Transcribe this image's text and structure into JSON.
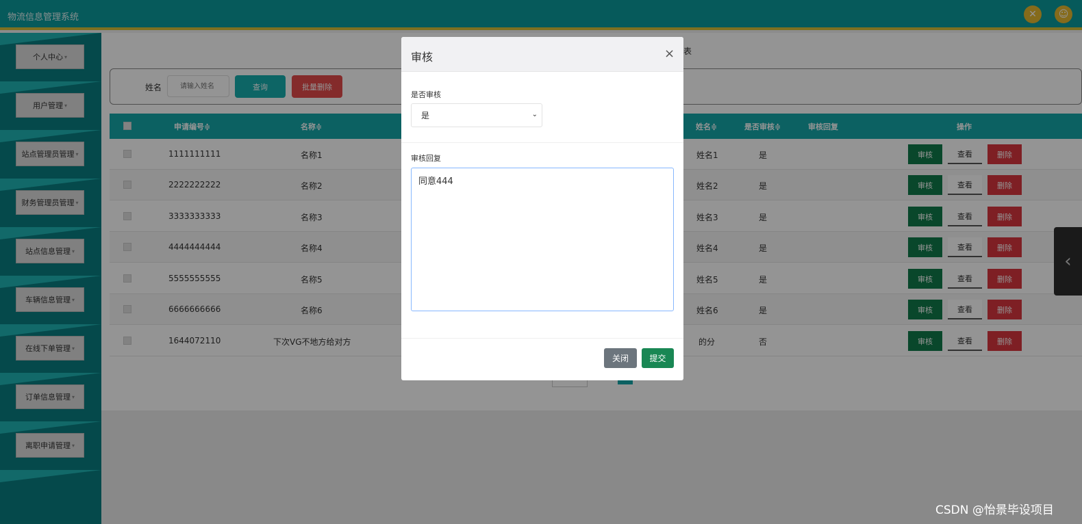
{
  "app": {
    "title": "物流信息管理系统"
  },
  "header": {
    "icon_fullscreen": "close-x-icon",
    "icon_user": "user-icon"
  },
  "sidebar": {
    "items": [
      {
        "label": "个人中心"
      },
      {
        "label": "用户管理"
      },
      {
        "label": "站点管理员管理"
      },
      {
        "label": "财务管理员管理"
      },
      {
        "label": "站点信息管理"
      },
      {
        "label": "车辆信息管理"
      },
      {
        "label": "在线下单管理"
      },
      {
        "label": "订单信息管理"
      },
      {
        "label": "离职申请管理"
      }
    ]
  },
  "main": {
    "heading_fragment": "表",
    "search": {
      "label": "姓名",
      "placeholder": "请输入姓名",
      "query_label": "查询",
      "batch_delete_label": "批量删除"
    },
    "table": {
      "headers": {
        "apply_no": "申请编号≑",
        "name": "名称≑",
        "person": "姓名≑",
        "audited": "是否审核≑",
        "reply": "审核回复",
        "actions": "操作"
      },
      "rows": [
        {
          "apply_no": "1111111111",
          "name": "名称1",
          "person": "姓名1",
          "audited": "是"
        },
        {
          "apply_no": "2222222222",
          "name": "名称2",
          "person": "姓名2",
          "audited": "是"
        },
        {
          "apply_no": "3333333333",
          "name": "名称3",
          "person": "姓名3",
          "audited": "是"
        },
        {
          "apply_no": "4444444444",
          "name": "名称4",
          "person": "姓名4",
          "audited": "是"
        },
        {
          "apply_no": "5555555555",
          "name": "名称5",
          "person": "姓名5",
          "audited": "是"
        },
        {
          "apply_no": "6666666666",
          "name": "名称6",
          "person": "姓名6",
          "audited": "是"
        },
        {
          "apply_no": "1644072110",
          "name": "下次VG不地方给对方",
          "person": "的分",
          "audited": "否"
        }
      ],
      "action_labels": {
        "review": "审核",
        "view": "查看",
        "delete": "删除"
      }
    }
  },
  "modal": {
    "title": "审核",
    "close_glyph": "×",
    "audit_label": "是否审核",
    "audit_value": "是",
    "reply_label": "审核回复",
    "reply_value": "同意444",
    "close_button": "关闭",
    "submit_button": "提交"
  },
  "watermark": "CSDN @怡景毕设项目",
  "colors": {
    "accent": "#15a8aa",
    "danger": "#d9363e",
    "review": "#117a4a",
    "submit": "#198754"
  }
}
